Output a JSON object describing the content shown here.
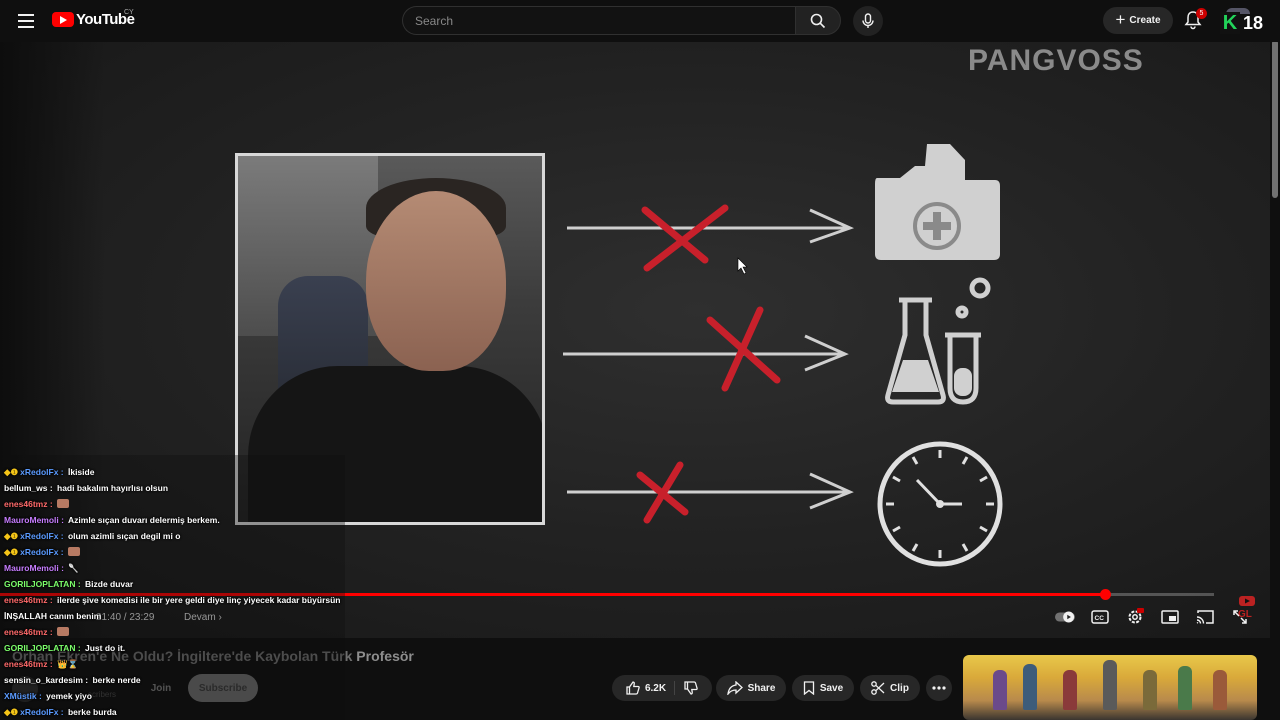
{
  "header": {
    "logo_text": "YouTube",
    "country_code": "CY",
    "search_placeholder": "Search",
    "create_label": "Create",
    "notification_count": "5",
    "overlay_k": "K",
    "overlay_rating": "18"
  },
  "video": {
    "watermark": "PANGVOSS",
    "current_time": "21:40 / 23:29",
    "chapter": "Devam",
    "progress": 0.91,
    "diagram_icons": [
      "medical-folder-icon",
      "lab-flasks-icon",
      "clock-icon"
    ]
  },
  "chat": {
    "messages": [
      {
        "user": "xRedolFx",
        "user_color": "#5b9bff",
        "badges": "◆❶",
        "text": "İkiside"
      },
      {
        "user": "bellum_ws",
        "user_color": "#ffffff",
        "badges": "",
        "text": "hadi bakalım hayırlısı olsun"
      },
      {
        "user": "enes46tmz",
        "user_color": "#ff6a6a",
        "badges": "",
        "text": "",
        "emote": true
      },
      {
        "user": "MauroMemoli",
        "user_color": "#c77dff",
        "badges": "",
        "text": "Azimle sıçan duvarı delermiş berkem."
      },
      {
        "user": "xRedolFx",
        "user_color": "#5b9bff",
        "badges": "◆❶",
        "text": "olum azimli sıçan degil mi o"
      },
      {
        "user": "xRedolFx",
        "user_color": "#5b9bff",
        "badges": "◆❶",
        "text": "",
        "emote": true
      },
      {
        "user": "MauroMemoli",
        "user_color": "#c77dff",
        "badges": "",
        "text": "🥄"
      },
      {
        "user": "GORILJOPLATAN",
        "user_color": "#7cff6b",
        "badges": "",
        "text": "Bizde duvar"
      },
      {
        "user": "enes46tmz",
        "user_color": "#ff6a6a",
        "badges": "",
        "text": "ilerde şive komedisi ile bir yere geldi diye linç yiyecek kadar büyürsün"
      },
      {
        "user": "",
        "user_color": "#ffffff",
        "badges": "",
        "text": "İNŞALLAH canım benim"
      },
      {
        "user": "enes46tmz",
        "user_color": "#ff6a6a",
        "badges": "",
        "text": "",
        "emote": true
      },
      {
        "user": "GORILJOPLATAN",
        "user_color": "#7cff6b",
        "badges": "",
        "text": "Just do it."
      },
      {
        "user": "enes46tmz",
        "user_color": "#ff6a6a",
        "badges": "",
        "text": "👑⌛"
      },
      {
        "user": "sensin_o_kardesim",
        "user_color": "#ffffff",
        "badges": "",
        "text": "berke nerde"
      },
      {
        "user": "XMüstik",
        "user_color": "#5b9bff",
        "badges": "",
        "text": "yemek yiyo"
      },
      {
        "user": "xRedolFx",
        "user_color": "#5b9bff",
        "badges": "◆❶",
        "text": "berke burda"
      }
    ]
  },
  "details": {
    "title_part1": "Orhan Ekren'e Ne Oldu? İngiltere'de Kaybolan Türk ",
    "title_part2": "Profesör",
    "subscribers": "scribers",
    "join_label": "Join",
    "subscribe_label": "Subscribe",
    "like_count": "6.2K",
    "share_label": "Share",
    "save_label": "Save",
    "clip_label": "Clip"
  }
}
